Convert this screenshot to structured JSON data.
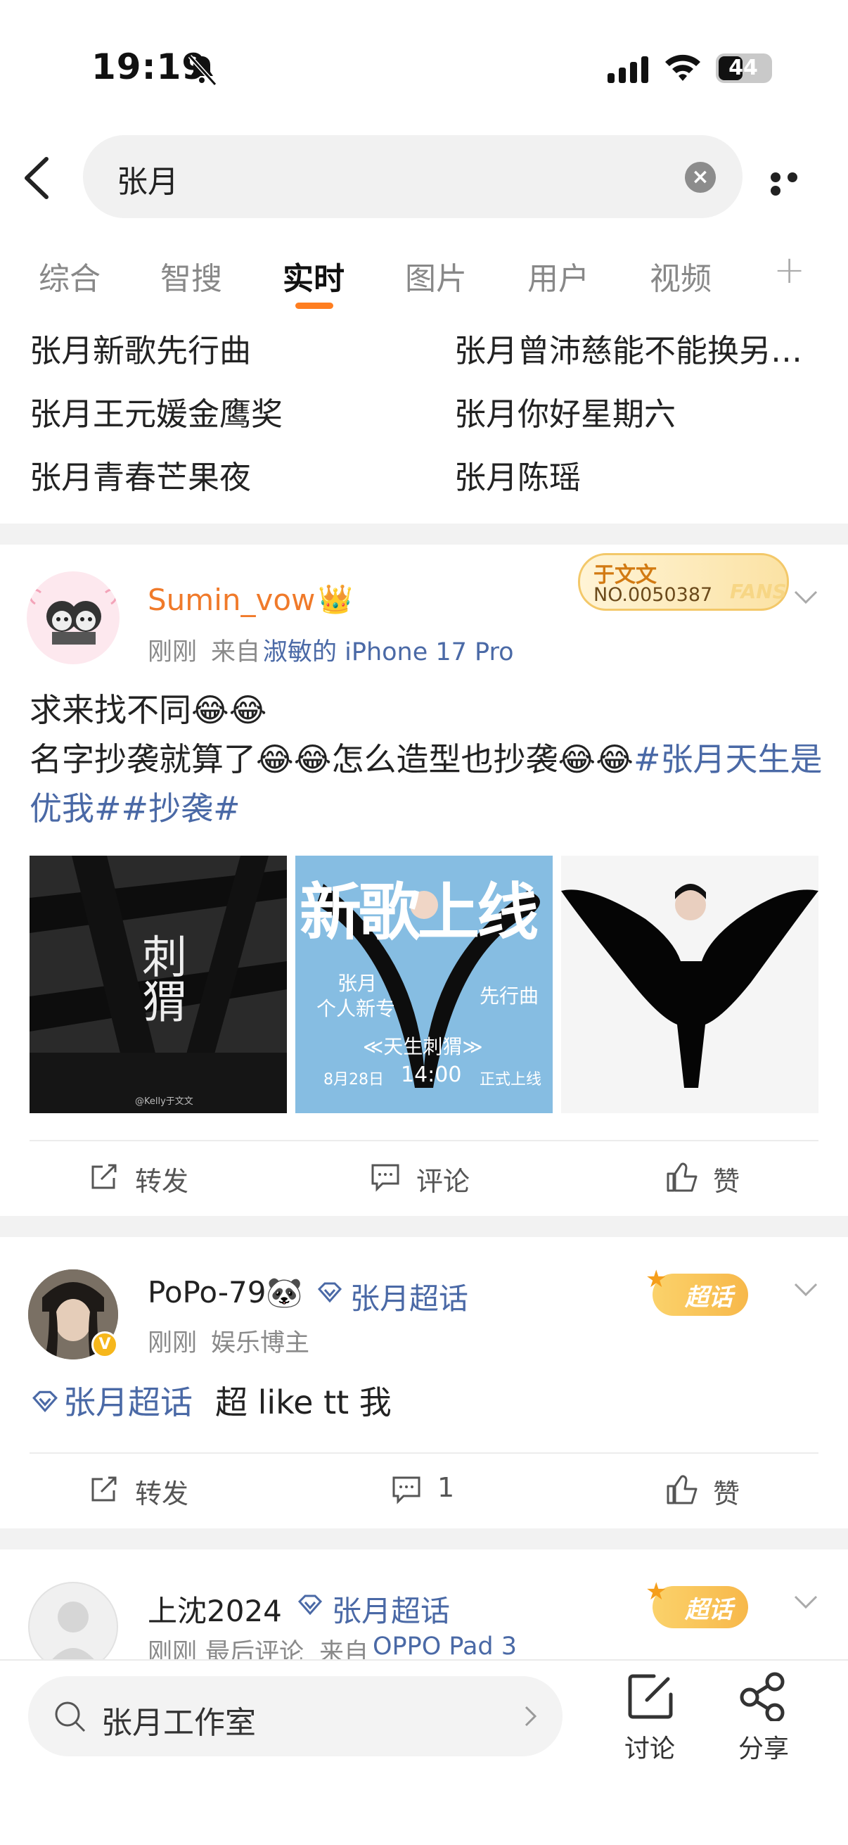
{
  "status_bar": {
    "time": "19:19",
    "battery": "44"
  },
  "search": {
    "query": "张月",
    "clear_icon": "clear-icon"
  },
  "tabs": [
    "综合",
    "智搜",
    "实时",
    "图片",
    "用户",
    "视频"
  ],
  "active_tab": "实时",
  "hot_searches": [
    "张月新歌先行曲",
    "张月曾沛慈能不能换另…",
    "张月王元媛金鹰奖",
    "张月你好星期六",
    "张月青春芒果夜",
    "张月陈瑶"
  ],
  "posts": [
    {
      "username": "Sumin_vow",
      "time": "刚刚",
      "source_prefix": "来自",
      "source": "淑敏的 iPhone 17 Pro",
      "fan_badge": {
        "name": "于文文",
        "number": "NO.0050387",
        "tag": "FANS"
      },
      "text_line1": "求来找不同😂😂",
      "text_line2a": "名字抄袭就算了😂😂怎么造型也抄袭😂😂",
      "text_tag1": "#张月天生是优我#",
      "text_tag2": "#抄袭#",
      "images": [
        {
          "title": "刺猬",
          "watermark": "@Kelly于文文"
        },
        {
          "headline": "新歌上线",
          "line1": "张月",
          "line2": "个人新专",
          "side": "先行曲",
          "album": "≪天生刺猬≫",
          "date": "8月28日",
          "clock": "14:00",
          "release": "正式上线"
        },
        {}
      ],
      "actions": {
        "repost": "转发",
        "comment": "评论",
        "like": "赞"
      }
    },
    {
      "username": "PoPo-79🐼",
      "supertopic": "张月超话",
      "time": "刚刚",
      "role": "娱乐博主",
      "badge": "超话",
      "text_topic": "张月超话",
      "text": "超 like tt 我",
      "actions": {
        "repost": "转发",
        "comment": "1",
        "like": "赞"
      }
    },
    {
      "username": "上沈2024",
      "supertopic": "张月超话",
      "time": "刚刚",
      "note": "最后评论",
      "source_prefix": "来自",
      "source": "OPPO Pad 3",
      "badge": "超话"
    }
  ],
  "bottom_bar": {
    "search_text": "张月工作室",
    "discuss": "讨论",
    "share": "分享"
  },
  "colors": {
    "accent": "#ff7e20",
    "link": "#4a69a6",
    "username_vip": "#f07a2a"
  }
}
